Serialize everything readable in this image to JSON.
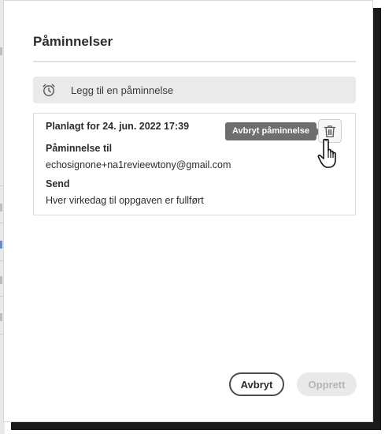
{
  "dialog": {
    "title": "Påminnelser",
    "add_reminder_label": "Legg til en påminnelse"
  },
  "reminder": {
    "scheduled": "Planlagt for 24. jun. 2022 17:39",
    "recipient_heading": "Påminnelse til",
    "recipient_value": "echosignone+na1revieewtony@gmail.com",
    "send_heading": "Send",
    "send_value": "Hver virkedag til oppgaven er fullført",
    "delete_tooltip": "Avbryt påminnelse"
  },
  "footer": {
    "cancel_label": "Avbryt",
    "create_label": "Opprett"
  },
  "icons": {
    "add": "alarm-clock-icon",
    "delete": "trash-icon",
    "pointer": "hand-pointer-cursor"
  }
}
